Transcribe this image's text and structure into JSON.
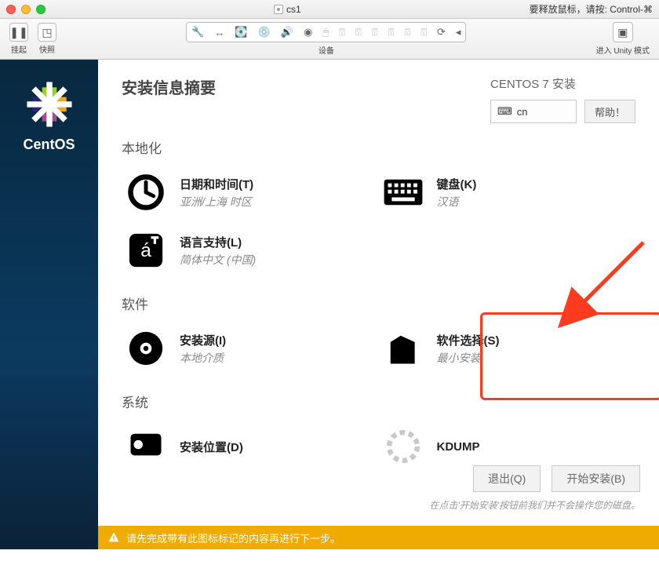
{
  "titlebar": {
    "title": "cs1",
    "hint": "要释放鼠标，请按: Control-⌘"
  },
  "host": {
    "suspend": "挂起",
    "snapshot": "快照",
    "devices_label": "设备",
    "unity": "进入 Unity 模式"
  },
  "vm": {
    "brand": "CentOS",
    "header_title": "安装信息摘要",
    "header_right": "CENTOS 7 安装",
    "kb_layout": "cn",
    "help": "帮助！",
    "sections": {
      "local": "本地化",
      "software": "软件",
      "system": "系统"
    },
    "items": {
      "datetime": {
        "title": "日期和时间(T)",
        "sub": "亚洲/上海 时区"
      },
      "keyboard": {
        "title": "键盘(K)",
        "sub": "汉语"
      },
      "lang": {
        "title": "语言支持(L)",
        "sub": "简体中文 (中国)"
      },
      "source": {
        "title": "安装源(I)",
        "sub": "本地介质"
      },
      "swsel": {
        "title": "软件选择(S)",
        "sub": "最小安装"
      },
      "dest": {
        "title": "安装位置(D)"
      },
      "kdump": {
        "title": "KDUMP"
      }
    },
    "buttons": {
      "quit": "退出(Q)",
      "begin": "开始安装(B)"
    },
    "hint": "在点击'开始安装'按钮前我们并不会操作您的磁盘。",
    "warning": "请先完成带有此图标标记的内容再进行下一步。"
  }
}
